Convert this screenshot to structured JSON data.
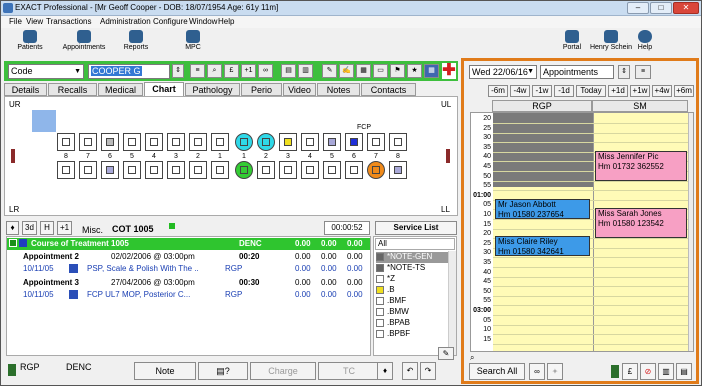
{
  "window": {
    "title": "EXACT Professional - [Mr Geoff Cooper - DOB: 18/07/1954 Age: 61y 11m]",
    "minimize": "–",
    "maximize": "□",
    "close": "✕"
  },
  "menu": [
    "File",
    "View",
    "Transactions",
    "Administration",
    "Configure",
    "Window",
    "Help"
  ],
  "toolbar": {
    "patients": "Patients",
    "appointments": "Appointments",
    "reports": "Reports",
    "mpc": "MPC",
    "portal": "Portal",
    "henry": "Henry Schein",
    "help": "Help"
  },
  "search": {
    "type": "Code",
    "value": "COOPER G"
  },
  "tabs": [
    "Details",
    "Recalls",
    "Medical",
    "Chart",
    "Pathology",
    "Perio",
    "Video",
    "Notes",
    "Contacts"
  ],
  "chart": {
    "ur": "UR",
    "ul": "UL",
    "lr": "LR",
    "ll": "LL",
    "upper_numbers": [
      "8",
      "7",
      "6",
      "5",
      "4",
      "3",
      "2",
      "1",
      "1",
      "2",
      "3",
      "4",
      "5",
      "6",
      "7",
      "8"
    ],
    "lower_numbers": [
      "8",
      "7",
      "6",
      "5",
      "4",
      "3",
      "2",
      "1",
      "1",
      "2",
      "3",
      "4",
      "5",
      "6",
      "7",
      "8"
    ],
    "fcp_label": "FCP",
    "scissors": "✂"
  },
  "lower": {
    "btn_1": "3d",
    "btn_2": "H",
    "btn_3": "+1",
    "misc": "Misc.",
    "cot": "COT 1005",
    "timer": "00:00:52",
    "service_list": "Service List",
    "all": "All"
  },
  "course": {
    "title": "Course of Treatment 1005",
    "type": "DENC",
    "v1": "0.00",
    "v2": "0.00",
    "v3": "0.00"
  },
  "appointments": [
    {
      "name": "Appointment 2",
      "when": "02/02/2006 @ 03:00pm",
      "dur": "00:20",
      "v1": "0.00",
      "v2": "0.00",
      "v3": "0.00",
      "date": "10/11/05",
      "desc": "PSP, Scale & Polish With The ..",
      "who": "RGP",
      "d1": "0.00",
      "d2": "0.00",
      "d3": "0.00"
    },
    {
      "name": "Appointment 3",
      "when": "27/04/2006 @ 03:00pm",
      "dur": "00:30",
      "v1": "0.00",
      "v2": "0.00",
      "v3": "0.00",
      "date": "10/11/05",
      "desc": "FCP  UL7  MOP, Posterior C...",
      "who": "RGP",
      "d1": "0.00",
      "d2": "0.00",
      "d3": "0.00"
    }
  ],
  "services": [
    "*NOTE-GEN",
    "*NOTE-TS",
    "*Z",
    ".B",
    ".BMF",
    ".BMW",
    ".BPAB",
    ".BPBF"
  ],
  "bottom": {
    "clinician": "RGP",
    "type": "DENC",
    "note": "Note",
    "charge": "Charge",
    "tc": "TC"
  },
  "diary": {
    "date": "Wed 22/06/16",
    "view": "Appointments",
    "nav": [
      "-6m",
      "-4w",
      "-1w",
      "-1d",
      "Today",
      "+1d",
      "+1w",
      "+4w",
      "+6m"
    ],
    "col1": "RGP",
    "col2": "SM",
    "times": [
      "20",
      "25",
      "30",
      "35",
      "40",
      "45",
      "50",
      "55",
      "01:00",
      "05",
      "10",
      "15",
      "20",
      "25",
      "30",
      "35",
      "40",
      "45",
      "50",
      "55",
      "03:00",
      "05",
      "10",
      "15"
    ],
    "events": [
      {
        "name": "Mr Jason Abbott",
        "phone": "Hm 01580 237654"
      },
      {
        "name": "Miss Claire Riley",
        "phone": "Hm 01580 342641"
      },
      {
        "name": "Miss Jennifer Pic",
        "phone": "Hm 01732 362552"
      },
      {
        "name": "Miss Sarah Jones",
        "phone": "Hm 01580 123542"
      }
    ],
    "search_all": "Search All"
  }
}
